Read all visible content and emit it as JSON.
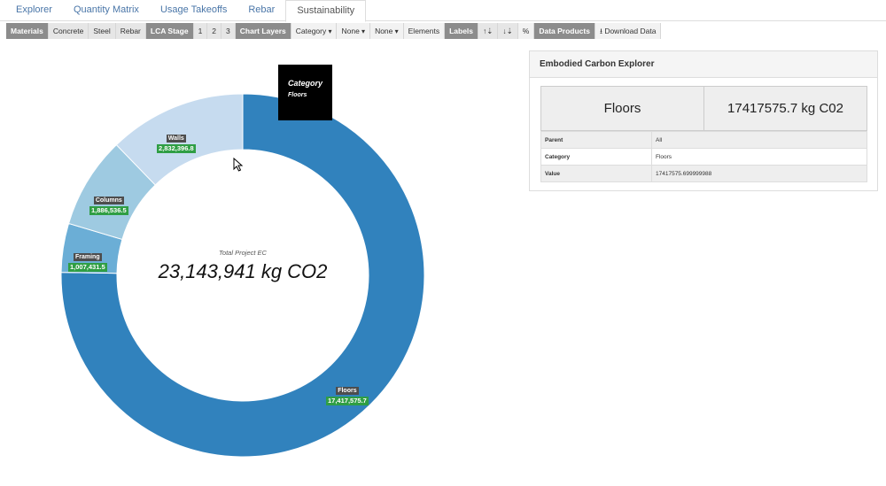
{
  "tabs": [
    "Explorer",
    "Quantity Matrix",
    "Usage Takeoffs",
    "Rebar",
    "Sustainability"
  ],
  "active_tab": "Sustainability",
  "toolbar": {
    "materials_label": "Materials",
    "concrete": "Concrete",
    "steel": "Steel",
    "rebar": "Rebar",
    "lca_stage_label": "LCA Stage",
    "stage_1": "1",
    "stage_2": "2",
    "stage_3": "3",
    "chart_layers_label": "Chart Layers",
    "layer_1": "Category",
    "layer_2": "None",
    "layer_3": "None",
    "elements": "Elements",
    "labels_label": "Labels",
    "sort_asc": "↑⇣",
    "sort_desc": "↓⇣",
    "percent": "%",
    "data_products_label": "Data Products",
    "download": "Download Data"
  },
  "chart": {
    "center_title": "Total Project EC",
    "center_value": "23,143,941 kg CO2",
    "tooltip_title": "Category",
    "tooltip_value": "Floors"
  },
  "chart_data": {
    "type": "pie",
    "title": "Total Project EC",
    "unit": "kg CO2",
    "total": 23143941,
    "slices": [
      {
        "name": "Floors",
        "value": 17417575.7,
        "label": "17,417,575.7",
        "color": "#3182bd"
      },
      {
        "name": "Framing",
        "value": 1007431.5,
        "label": "1,007,431.5",
        "color": "#6baed6"
      },
      {
        "name": "Columns",
        "value": 1886536.5,
        "label": "1,886,536.5",
        "color": "#9ecae1"
      },
      {
        "name": "Walls",
        "value": 2832396.8,
        "label": "2,832,396.8",
        "color": "#c6dbef"
      }
    ]
  },
  "panel": {
    "title": "Embodied Carbon Explorer",
    "selected_name": "Floors",
    "selected_value": "17417575.7 kg C02",
    "rows": [
      {
        "key": "Parent",
        "value": "All"
      },
      {
        "key": "Category",
        "value": "Floors"
      },
      {
        "key": "Value",
        "value": "17417575.699999988"
      }
    ]
  }
}
